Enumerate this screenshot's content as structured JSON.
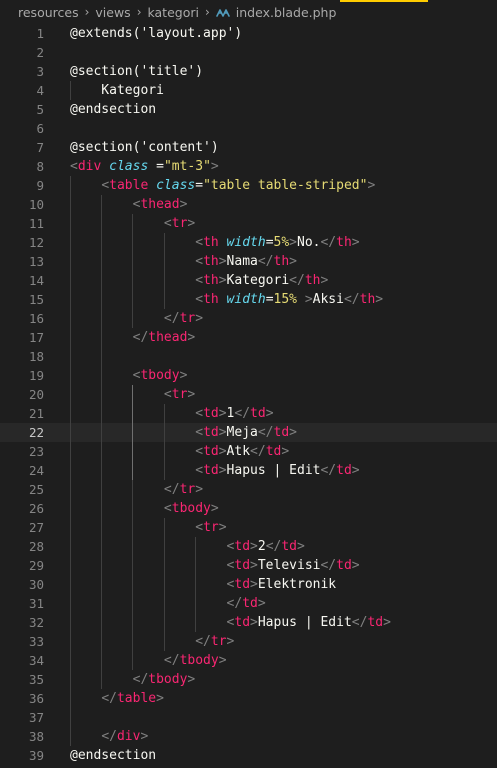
{
  "colors": {
    "background": "#1e1e1e",
    "breadcrumb_text": "#a9a9a9",
    "line_number": "#858585",
    "line_number_active": "#c6c6c6",
    "active_line_bg": "#282828",
    "indent_guide": "#404040",
    "indent_guide_active": "#707070",
    "tag_bracket": "#808080",
    "tag_name": "#f92672",
    "attr_name": "#66d9ef",
    "attr_value": "#e6db74",
    "text": "#f8f8f2",
    "top_accent": "#ffcc00",
    "file_icon": "#519aba"
  },
  "breadcrumb": {
    "segments": [
      "resources",
      "views",
      "kategori"
    ],
    "file_icon": "blade-file-icon",
    "file_name": "index.blade.php"
  },
  "editor": {
    "active_line": 22,
    "lines": [
      {
        "n": "1",
        "tokens": [
          [
            "@extends('layout.app')",
            "text"
          ]
        ]
      },
      {
        "n": "2",
        "tokens": []
      },
      {
        "n": "3",
        "tokens": [
          [
            "@section('title')",
            "text"
          ]
        ]
      },
      {
        "n": "4",
        "tokens": [
          [
            "    Kategori",
            "text"
          ]
        ]
      },
      {
        "n": "5",
        "tokens": [
          [
            "@endsection",
            "text"
          ]
        ]
      },
      {
        "n": "6",
        "tokens": []
      },
      {
        "n": "7",
        "tokens": [
          [
            "@section('content')",
            "text"
          ]
        ]
      },
      {
        "n": "8",
        "tokens": [
          [
            "<",
            "tag_bracket"
          ],
          [
            "div",
            "tag_name"
          ],
          [
            " ",
            "text"
          ],
          [
            "class",
            "attr_name"
          ],
          [
            " =",
            "text"
          ],
          [
            "\"mt-3\"",
            "attr_value"
          ],
          [
            ">",
            "tag_bracket"
          ]
        ]
      },
      {
        "n": "9",
        "tokens": [
          [
            "    ",
            "text"
          ],
          [
            "<",
            "tag_bracket"
          ],
          [
            "table",
            "tag_name"
          ],
          [
            " ",
            "text"
          ],
          [
            "class",
            "attr_name"
          ],
          [
            "=",
            "text"
          ],
          [
            "\"table table-striped\"",
            "attr_value"
          ],
          [
            ">",
            "tag_bracket"
          ]
        ]
      },
      {
        "n": "10",
        "tokens": [
          [
            "        ",
            "text"
          ],
          [
            "<",
            "tag_bracket"
          ],
          [
            "thead",
            "tag_name"
          ],
          [
            ">",
            "tag_bracket"
          ]
        ]
      },
      {
        "n": "11",
        "tokens": [
          [
            "            ",
            "text"
          ],
          [
            "<",
            "tag_bracket"
          ],
          [
            "tr",
            "tag_name"
          ],
          [
            ">",
            "tag_bracket"
          ]
        ]
      },
      {
        "n": "12",
        "tokens": [
          [
            "                ",
            "text"
          ],
          [
            "<",
            "tag_bracket"
          ],
          [
            "th",
            "tag_name"
          ],
          [
            " ",
            "text"
          ],
          [
            "width",
            "attr_name"
          ],
          [
            "=",
            "text"
          ],
          [
            "5%",
            "attr_value"
          ],
          [
            ">",
            "tag_bracket"
          ],
          [
            "No.",
            "text"
          ],
          [
            "</",
            "tag_bracket"
          ],
          [
            "th",
            "tag_name"
          ],
          [
            ">",
            "tag_bracket"
          ]
        ]
      },
      {
        "n": "13",
        "tokens": [
          [
            "                ",
            "text"
          ],
          [
            "<",
            "tag_bracket"
          ],
          [
            "th",
            "tag_name"
          ],
          [
            ">",
            "tag_bracket"
          ],
          [
            "Nama",
            "text"
          ],
          [
            "</",
            "tag_bracket"
          ],
          [
            "th",
            "tag_name"
          ],
          [
            ">",
            "tag_bracket"
          ]
        ]
      },
      {
        "n": "14",
        "tokens": [
          [
            "                ",
            "text"
          ],
          [
            "<",
            "tag_bracket"
          ],
          [
            "th",
            "tag_name"
          ],
          [
            ">",
            "tag_bracket"
          ],
          [
            "Kategori",
            "text"
          ],
          [
            "</",
            "tag_bracket"
          ],
          [
            "th",
            "tag_name"
          ],
          [
            ">",
            "tag_bracket"
          ]
        ]
      },
      {
        "n": "15",
        "tokens": [
          [
            "                ",
            "text"
          ],
          [
            "<",
            "tag_bracket"
          ],
          [
            "th",
            "tag_name"
          ],
          [
            " ",
            "text"
          ],
          [
            "width",
            "attr_name"
          ],
          [
            "=",
            "text"
          ],
          [
            "15%",
            "attr_value"
          ],
          [
            " >",
            "tag_bracket"
          ],
          [
            "Aksi",
            "text"
          ],
          [
            "</",
            "tag_bracket"
          ],
          [
            "th",
            "tag_name"
          ],
          [
            ">",
            "tag_bracket"
          ]
        ]
      },
      {
        "n": "16",
        "tokens": [
          [
            "            ",
            "text"
          ],
          [
            "</",
            "tag_bracket"
          ],
          [
            "tr",
            "tag_name"
          ],
          [
            ">",
            "tag_bracket"
          ]
        ]
      },
      {
        "n": "17",
        "tokens": [
          [
            "        ",
            "text"
          ],
          [
            "</",
            "tag_bracket"
          ],
          [
            "thead",
            "tag_name"
          ],
          [
            ">",
            "tag_bracket"
          ]
        ]
      },
      {
        "n": "18",
        "tokens": []
      },
      {
        "n": "19",
        "tokens": [
          [
            "        ",
            "text"
          ],
          [
            "<",
            "tag_bracket"
          ],
          [
            "tbody",
            "tag_name"
          ],
          [
            ">",
            "tag_bracket"
          ]
        ]
      },
      {
        "n": "20",
        "tokens": [
          [
            "            ",
            "text"
          ],
          [
            "<",
            "tag_bracket"
          ],
          [
            "tr",
            "tag_name"
          ],
          [
            ">",
            "tag_bracket"
          ]
        ]
      },
      {
        "n": "21",
        "tokens": [
          [
            "                ",
            "text"
          ],
          [
            "<",
            "tag_bracket"
          ],
          [
            "td",
            "tag_name"
          ],
          [
            ">",
            "tag_bracket"
          ],
          [
            "1",
            "text"
          ],
          [
            "</",
            "tag_bracket"
          ],
          [
            "td",
            "tag_name"
          ],
          [
            ">",
            "tag_bracket"
          ]
        ]
      },
      {
        "n": "22",
        "tokens": [
          [
            "                ",
            "text"
          ],
          [
            "<",
            "tag_bracket"
          ],
          [
            "td",
            "tag_name"
          ],
          [
            ">",
            "tag_bracket"
          ],
          [
            "Meja",
            "text"
          ],
          [
            "</",
            "tag_bracket"
          ],
          [
            "td",
            "tag_name"
          ],
          [
            ">",
            "tag_bracket"
          ]
        ]
      },
      {
        "n": "23",
        "tokens": [
          [
            "                ",
            "text"
          ],
          [
            "<",
            "tag_bracket"
          ],
          [
            "td",
            "tag_name"
          ],
          [
            ">",
            "tag_bracket"
          ],
          [
            "Atk",
            "text"
          ],
          [
            "</",
            "tag_bracket"
          ],
          [
            "td",
            "tag_name"
          ],
          [
            ">",
            "tag_bracket"
          ]
        ]
      },
      {
        "n": "24",
        "tokens": [
          [
            "                ",
            "text"
          ],
          [
            "<",
            "tag_bracket"
          ],
          [
            "td",
            "tag_name"
          ],
          [
            ">",
            "tag_bracket"
          ],
          [
            "Hapus | Edit",
            "text"
          ],
          [
            "</",
            "tag_bracket"
          ],
          [
            "td",
            "tag_name"
          ],
          [
            ">",
            "tag_bracket"
          ]
        ]
      },
      {
        "n": "25",
        "tokens": [
          [
            "            ",
            "text"
          ],
          [
            "</",
            "tag_bracket"
          ],
          [
            "tr",
            "tag_name"
          ],
          [
            ">",
            "tag_bracket"
          ]
        ]
      },
      {
        "n": "26",
        "tokens": [
          [
            "            ",
            "text"
          ],
          [
            "<",
            "tag_bracket"
          ],
          [
            "tbody",
            "tag_name"
          ],
          [
            ">",
            "tag_bracket"
          ]
        ]
      },
      {
        "n": "27",
        "tokens": [
          [
            "                ",
            "text"
          ],
          [
            "<",
            "tag_bracket"
          ],
          [
            "tr",
            "tag_name"
          ],
          [
            ">",
            "tag_bracket"
          ]
        ]
      },
      {
        "n": "28",
        "tokens": [
          [
            "                    ",
            "text"
          ],
          [
            "<",
            "tag_bracket"
          ],
          [
            "td",
            "tag_name"
          ],
          [
            ">",
            "tag_bracket"
          ],
          [
            "2",
            "text"
          ],
          [
            "</",
            "tag_bracket"
          ],
          [
            "td",
            "tag_name"
          ],
          [
            ">",
            "tag_bracket"
          ]
        ]
      },
      {
        "n": "29",
        "tokens": [
          [
            "                    ",
            "text"
          ],
          [
            "<",
            "tag_bracket"
          ],
          [
            "td",
            "tag_name"
          ],
          [
            ">",
            "tag_bracket"
          ],
          [
            "Televisi",
            "text"
          ],
          [
            "</",
            "tag_bracket"
          ],
          [
            "td",
            "tag_name"
          ],
          [
            ">",
            "tag_bracket"
          ]
        ]
      },
      {
        "n": "30",
        "tokens": [
          [
            "                    ",
            "text"
          ],
          [
            "<",
            "tag_bracket"
          ],
          [
            "td",
            "tag_name"
          ],
          [
            ">",
            "tag_bracket"
          ],
          [
            "Elektronik",
            "text"
          ]
        ]
      },
      {
        "n": "31",
        "tokens": [
          [
            "                    ",
            "text"
          ],
          [
            "</",
            "tag_bracket"
          ],
          [
            "td",
            "tag_name"
          ],
          [
            ">",
            "tag_bracket"
          ]
        ]
      },
      {
        "n": "32",
        "tokens": [
          [
            "                    ",
            "text"
          ],
          [
            "<",
            "tag_bracket"
          ],
          [
            "td",
            "tag_name"
          ],
          [
            ">",
            "tag_bracket"
          ],
          [
            "Hapus | Edit",
            "text"
          ],
          [
            "</",
            "tag_bracket"
          ],
          [
            "td",
            "tag_name"
          ],
          [
            ">",
            "tag_bracket"
          ]
        ]
      },
      {
        "n": "33",
        "tokens": [
          [
            "                ",
            "text"
          ],
          [
            "</",
            "tag_bracket"
          ],
          [
            "tr",
            "tag_name"
          ],
          [
            ">",
            "tag_bracket"
          ]
        ]
      },
      {
        "n": "34",
        "tokens": [
          [
            "            ",
            "text"
          ],
          [
            "</",
            "tag_bracket"
          ],
          [
            "tbody",
            "tag_name"
          ],
          [
            ">",
            "tag_bracket"
          ]
        ]
      },
      {
        "n": "35",
        "tokens": [
          [
            "        ",
            "text"
          ],
          [
            "</",
            "tag_bracket"
          ],
          [
            "tbody",
            "tag_name"
          ],
          [
            ">",
            "tag_bracket"
          ]
        ]
      },
      {
        "n": "36",
        "tokens": [
          [
            "    ",
            "text"
          ],
          [
            "</",
            "tag_bracket"
          ],
          [
            "table",
            "tag_name"
          ],
          [
            ">",
            "tag_bracket"
          ]
        ]
      },
      {
        "n": "37",
        "tokens": []
      },
      {
        "n": "38",
        "tokens": [
          [
            "    ",
            "text"
          ],
          [
            "</",
            "tag_bracket"
          ],
          [
            "div",
            "tag_name"
          ],
          [
            ">",
            "tag_bracket"
          ]
        ]
      },
      {
        "n": "39",
        "tokens": [
          [
            "@endsection",
            "text"
          ]
        ]
      }
    ]
  }
}
